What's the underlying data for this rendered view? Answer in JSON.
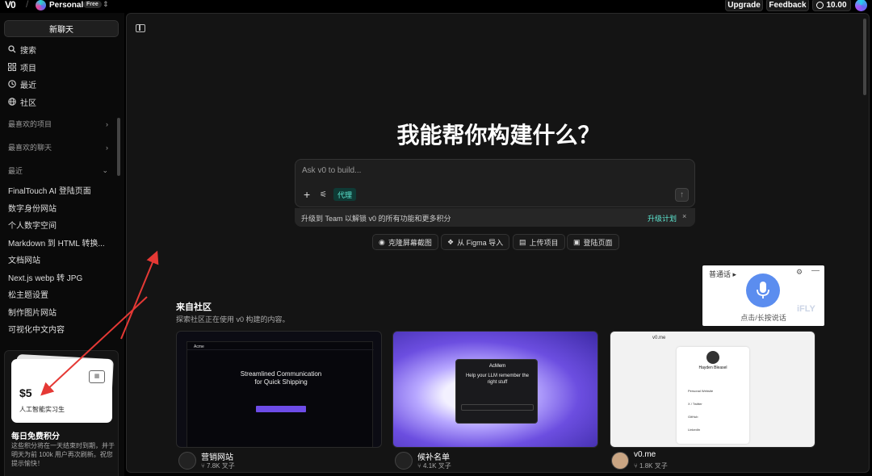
{
  "topbar": {
    "logo": "V0",
    "workspace": "Personal",
    "plan_badge": "Free",
    "upgrade": "Upgrade",
    "feedback": "Feedback",
    "credits": "10.00"
  },
  "sidebar": {
    "new_chat": "新聊天",
    "nav": [
      {
        "label": "搜索",
        "icon": "search-icon"
      },
      {
        "label": "项目",
        "icon": "grid-icon"
      },
      {
        "label": "最近",
        "icon": "clock-icon"
      },
      {
        "label": "社区",
        "icon": "globe-icon"
      }
    ],
    "fav_projects": "最喜欢的项目",
    "fav_chats": "最喜欢的聊天",
    "recent_section": "最近",
    "recent": [
      "FinalTouch AI 登陆页面",
      "数字身份网站",
      "个人数字空间",
      "Markdown 到 HTML 转换...",
      "文档网站",
      "Next.js webp 转 JPG",
      "松主题设置",
      "制作图片网站",
      "可视化中文内容"
    ],
    "credit_card": {
      "amount": "$5",
      "title": "人工智能实习生"
    },
    "daily_credits_title": "每日免费积分",
    "daily_credits_desc": "这些积分将在一天结束时到期，并于明天为前 100k 用户再次刷新。祝您提示愉快！"
  },
  "main": {
    "hero": "我能帮你构建什么？",
    "prompt_placeholder": "Ask v0 to build...",
    "agent_label": "代理",
    "upgrade_text": "升级到 Team 以解锁 v0 的所有功能和更多积分",
    "upgrade_link": "升级计划",
    "quick_actions": [
      {
        "label": "克隆屏幕截图",
        "icon": "camera-icon"
      },
      {
        "label": "从 Figma 导入",
        "icon": "figma-icon"
      },
      {
        "label": "上传项目",
        "icon": "upload-icon"
      },
      {
        "label": "登陆页面",
        "icon": "layout-icon"
      }
    ],
    "community_title": "来自社区",
    "community_sub": "探索社区正在使用 v0 构建的内容。",
    "community": [
      {
        "label": "营销网站",
        "forks": "7.8K 叉子"
      },
      {
        "label": "候补名单",
        "forks": "4.1K 叉子"
      },
      {
        "label": "v0.me",
        "forks": "1.8K 叉子"
      }
    ]
  },
  "voice_widget": {
    "lang": "普通话",
    "hint": "点击/长按说话",
    "brand": "iFLY"
  },
  "thumbs": {
    "t1_brand": "Acme",
    "t1_headline": "Streamlined Communication for Quick Shipping",
    "t2_brand": "AcMem",
    "t2_headline": "Help your LLM remember the right stuff",
    "t3_domain": "v0.me",
    "t3_name": "Hayden Bleasel",
    "t3_links": [
      "Personal Website",
      "X / Twitter",
      "GitHub",
      "LinkedIn"
    ]
  },
  "colors": {
    "accent": "#5eead4",
    "background": "#000000",
    "panel": "#141414"
  }
}
